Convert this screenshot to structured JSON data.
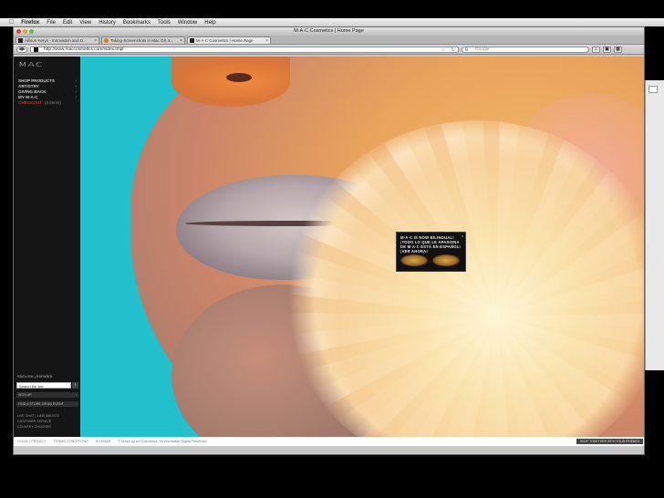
{
  "menubar": {
    "app": "Firefox",
    "items": [
      "File",
      "Edit",
      "View",
      "History",
      "Bookmarks",
      "Tools",
      "Window",
      "Help"
    ]
  },
  "window": {
    "title": "M·A·C Cosmetics | Home Page",
    "tabs": [
      {
        "label": "Allison Keryx - Innovation and D...",
        "active": false
      },
      {
        "label": "Taking Screenshots in Mac OS X...",
        "active": false
      },
      {
        "label": "M·A·C Cosmetics | Home Page",
        "active": true
      }
    ],
    "url": "http://www.maccosmetics.com/index.tmpl",
    "search_placeholder": "Google"
  },
  "sidebar": {
    "logo": "MAC",
    "menu": [
      {
        "label": "SHOP PRODUCTS",
        "sub": "",
        "red": false
      },
      {
        "label": "ARTISTRY",
        "sub": "",
        "red": false
      },
      {
        "label": "GIVING BACK",
        "sub": "",
        "red": false
      },
      {
        "label": "MY M·A·C",
        "sub": "",
        "red": false
      },
      {
        "label": "CHECKOUT",
        "sub": "(0 items)",
        "red": true
      }
    ],
    "languages": "ENGLISH | ESPAÑOL",
    "search_placeholder": "Search the site",
    "signup": "SIGN UP",
    "find_store": "FIND A STORE OR AN EVENT",
    "live_chat": "LIVE CHAT | 1.800.588.0070",
    "customer_service": "CUSTOMER SERVICE",
    "country": "COUNTRY CHOOSER"
  },
  "promo": {
    "lines": [
      "M·A·C IS NOW BILINGUAL!",
      "¡TODO LO QUE LE APASIONA",
      "DE M·A·C ESTÁ EN ESPAÑOL!",
      "¡VER AHORA!"
    ],
    "close": "x"
  },
  "footer": {
    "links": [
      "LEGAL | PRIVACY",
      "TERMS CONDITIONS",
      "SITEMAP"
    ],
    "copyright": "© Make-up Art Cosmetics. All Worldwide Rights Reserved.",
    "shop_button": "SHOP TOGETHER WITH YOUR FRIENDS"
  },
  "colors": {
    "accent_red": "#e2252b",
    "sidebar_bg": "#151515",
    "hero_teal": "#21c0cc"
  }
}
